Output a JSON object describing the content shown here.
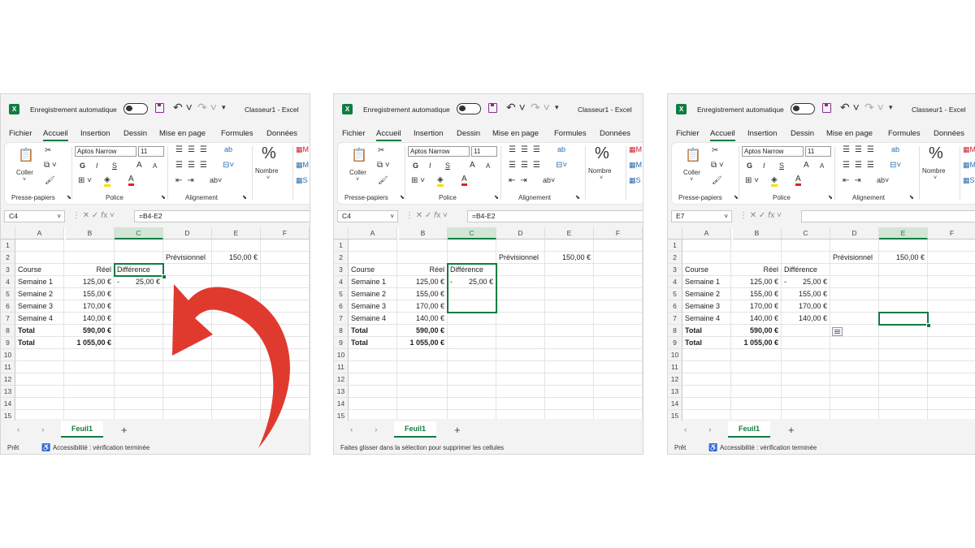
{
  "common": {
    "autosave_label": "Enregistrement automatique",
    "title": "Classeur1  -  Excel",
    "menu": [
      "Fichier",
      "Accueil",
      "Insertion",
      "Dessin",
      "Mise en page",
      "Formules",
      "Données"
    ],
    "ribbon": {
      "paste_label": "Coller",
      "clipboard_group": "Presse-papiers",
      "font_name": "Aptos Narrow",
      "font_size": "11",
      "bold": "G",
      "italic": "I",
      "underline": "S",
      "grow_font": "A",
      "shrink_font": "A",
      "font_group": "Police",
      "alignment_group": "Alignement",
      "number_icon": "%",
      "number_label": "Nombre"
    },
    "columns": [
      "A",
      "B",
      "C",
      "D",
      "E",
      "F"
    ],
    "rows": [
      "1",
      "2",
      "3",
      "4",
      "5",
      "6",
      "7",
      "8",
      "9",
      "10",
      "11",
      "12",
      "13",
      "14",
      "15"
    ],
    "sheet_name": "Feuil1",
    "add_sheet": "+",
    "nav_arrows": "‹ ›",
    "accent_color": "#107c41",
    "arrow_color": "#e03a2f"
  },
  "panels": [
    {
      "namebox": "C4",
      "formula": "=B4-E2",
      "selected_col": "C",
      "cells": {
        "E2": "150,00 €",
        "D2": "Prévisionnel",
        "A3": "Course",
        "B3": "Réel",
        "C3": "Différence",
        "A4": "Semaine 1",
        "B4": "125,00 €",
        "C4a": "-",
        "C4b": "25,00 €",
        "A5": "Semaine 2",
        "B5": "155,00 €",
        "A6": "Semaine 3",
        "B6": "170,00 €",
        "A7": "Semaine 4",
        "B7": "140,00 €",
        "A8": "Total",
        "B8": "590,00 €",
        "A9": "Total",
        "B9": "1 055,00 €"
      },
      "status_left": "Prêt",
      "status_right": "Accessibilité : vérification terminée"
    },
    {
      "namebox": "C4",
      "formula": "=B4-E2",
      "selected_col": "C",
      "cells": {
        "E2": "150,00 €",
        "D2": "Prévisionnel",
        "A3": "Course",
        "B3": "Réel",
        "C3": "Différence",
        "A4": "Semaine 1",
        "B4": "125,00 €",
        "C4a": "-",
        "C4b": "25,00 €",
        "A5": "Semaine 2",
        "B5": "155,00 €",
        "A6": "Semaine 3",
        "B6": "170,00 €",
        "A7": "Semaine 4",
        "B7": "140,00 €",
        "A8": "Total",
        "B8": "590,00 €",
        "A9": "Total",
        "B9": "1 055,00 €"
      },
      "status_left": "Faites glisser dans la sélection pour supprimer les cellules"
    },
    {
      "namebox": "E7",
      "formula": "",
      "selected_col": "E",
      "cells": {
        "E2": "150,00 €",
        "D2": "Prévisionnel",
        "A3": "Course",
        "B3": "Réel",
        "C3": "Différence",
        "A4": "Semaine 1",
        "B4": "125,00 €",
        "C4a": "-",
        "C4b": "25,00 €",
        "A5": "Semaine 2",
        "B5": "155,00 €",
        "C5": "155,00 €",
        "A6": "Semaine 3",
        "B6": "170,00 €",
        "C6": "170,00 €",
        "A7": "Semaine 4",
        "B7": "140,00 €",
        "C7": "140,00 €",
        "A8": "Total",
        "B8": "590,00 €",
        "A9": "Total",
        "B9": "1 055,00 €"
      },
      "status_left": "Prêt",
      "status_right": "Accessibilité : vérification terminée"
    }
  ]
}
